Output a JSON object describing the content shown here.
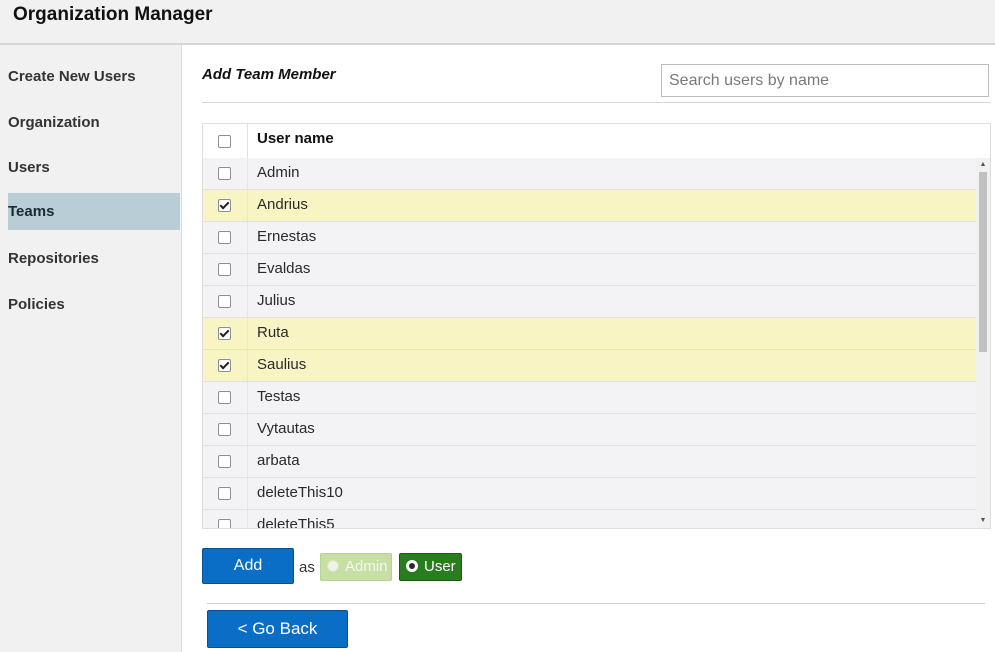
{
  "app": {
    "title": "Organization Manager"
  },
  "sidebar": {
    "items": [
      {
        "label": "Create New Users",
        "active": false
      },
      {
        "label": "Organization",
        "active": false
      },
      {
        "label": "Users",
        "active": false
      },
      {
        "label": "Teams",
        "active": true
      },
      {
        "label": "Repositories",
        "active": false
      },
      {
        "label": "Policies",
        "active": false
      }
    ]
  },
  "main": {
    "title": "Add Team Member",
    "search": {
      "placeholder": "Search users by name",
      "value": ""
    },
    "table": {
      "header": "User name",
      "rows": [
        {
          "name": "Admin",
          "checked": false
        },
        {
          "name": "Andrius",
          "checked": true
        },
        {
          "name": "Ernestas",
          "checked": false
        },
        {
          "name": "Evaldas",
          "checked": false
        },
        {
          "name": "Julius",
          "checked": false
        },
        {
          "name": "Ruta",
          "checked": true
        },
        {
          "name": "Saulius",
          "checked": true
        },
        {
          "name": "Testas",
          "checked": false
        },
        {
          "name": "Vytautas",
          "checked": false
        },
        {
          "name": "arbata",
          "checked": false
        },
        {
          "name": "deleteThis10",
          "checked": false
        },
        {
          "name": "deleteThis5",
          "checked": false
        }
      ]
    },
    "add_label": "Add",
    "as_label": "as",
    "roles": {
      "admin": "Admin",
      "user": "User",
      "selected": "User"
    },
    "back_label": "< Go Back"
  },
  "colors": {
    "accent_blue": "#0a6ec7",
    "selected_row": "#f8f4c3",
    "active_sidebar": "#b9cdd6",
    "user_role_green": "#2a7d1f",
    "admin_role_green": "#c5dfa5"
  }
}
